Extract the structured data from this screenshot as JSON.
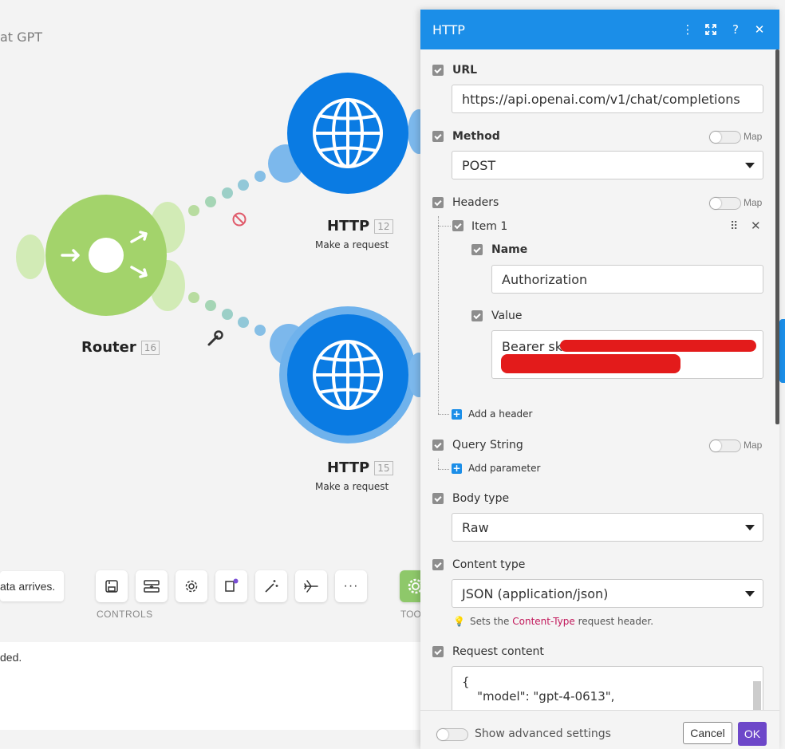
{
  "canvas": {
    "scenario_title": "at GPT",
    "router": {
      "label": "Router",
      "id": "16"
    },
    "http_top": {
      "label": "HTTP",
      "id": "12",
      "subtitle": "Make a request"
    },
    "http_bottom": {
      "label": "HTTP",
      "id": "15",
      "subtitle": "Make a request"
    },
    "trigger_message": "ata arrives.",
    "controls_label": "CONTROLS",
    "tools_label": "TOO",
    "log_message": "ded.",
    "toolbar_icons": [
      "save-icon",
      "auto-align-icon",
      "gear-icon",
      "notes-icon",
      "magic-wand-icon",
      "airplane-icon",
      "more-icon"
    ]
  },
  "panel": {
    "title": "HTTP",
    "url": {
      "label": "URL",
      "value": "https://api.openai.com/v1/chat/completions"
    },
    "method": {
      "label": "Method",
      "value": "POST",
      "map_label": "Map"
    },
    "headers": {
      "label": "Headers",
      "map_label": "Map",
      "item_label": "Item 1",
      "name_label": "Name",
      "name_value": "Authorization",
      "value_label": "Value",
      "value_prefix": "Bearer sk",
      "add_label": "Add a header"
    },
    "query_string": {
      "label": "Query String",
      "map_label": "Map",
      "add_label": "Add parameter"
    },
    "body_type": {
      "label": "Body type",
      "value": "Raw"
    },
    "content_type": {
      "label": "Content type",
      "value": "JSON (application/json)",
      "hint_prefix": "Sets the",
      "hint_link": "Content-Type",
      "hint_suffix": "request header."
    },
    "request_content": {
      "label": "Request content",
      "line1": "{",
      "line2": "    \"model\": \"gpt-4-0613\","
    },
    "footer": {
      "advanced_label": "Show advanced settings",
      "cancel_label": "Cancel",
      "ok_label": "OK"
    }
  },
  "colors": {
    "router_green": "#a3d36b",
    "http_blue": "#0a7be3",
    "panel_header": "#1b8ee8",
    "ok_button": "#6d47c9"
  }
}
